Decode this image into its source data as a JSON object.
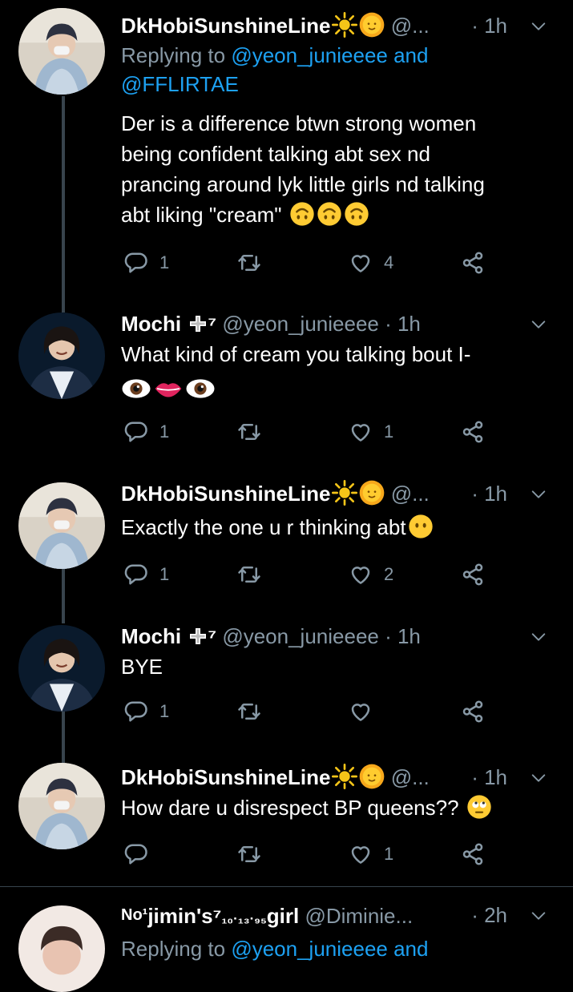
{
  "tweets": [
    {
      "name": "DkHobiSunshineLine",
      "handle": "@...",
      "time": "· 1h",
      "reply_label": "Replying to",
      "reply_link1": "@yeon_junieeee and",
      "reply_link2": "@FFLIRTAE",
      "text_line1": "Der is a difference btwn strong women",
      "text_line2": "being confident talking abt sex nd",
      "text_line3": "prancing around lyk little girls nd talking",
      "text_line4": "abt liking \"cream\"",
      "replies": "1",
      "retweets": "",
      "likes": "4"
    },
    {
      "name": "Mochi",
      "name_suffix": "⁷",
      "handle": "@yeon_junieeee",
      "time": "· 1h",
      "text_line1": "What kind of cream you talking bout I-",
      "replies": "1",
      "retweets": "",
      "likes": "1"
    },
    {
      "name": "DkHobiSunshineLine",
      "handle": "@...",
      "time": "· 1h",
      "text_line1": "Exactly the one u r thinking abt",
      "replies": "1",
      "retweets": "",
      "likes": "2"
    },
    {
      "name": "Mochi",
      "name_suffix": "⁷",
      "handle": "@yeon_junieeee",
      "time": "· 1h",
      "text_line1": "BYE",
      "replies": "1",
      "retweets": "",
      "likes": ""
    },
    {
      "name": "DkHobiSunshineLine",
      "handle": "@...",
      "time": "· 1h",
      "text_line1": "How dare u disrespect BP queens??",
      "replies": "",
      "retweets": "",
      "likes": "1"
    },
    {
      "name_prefix": "No¹",
      "name": "jimin's",
      "name_sup": "⁷",
      "name_sub": "₁₀·₁₃·₉₅",
      "name_tail": "girl",
      "handle": "@Diminie...",
      "time": "· 2h",
      "reply_label": "Replying to",
      "reply_link1": "@yeon_junieeee and"
    }
  ],
  "colors": {
    "background": "#000000",
    "secondary": "#8899a6",
    "link": "#1da1f2",
    "line": "#38444d"
  },
  "icons": [
    "reply-icon",
    "retweet-icon",
    "like-icon",
    "share-icon",
    "chevron-down-icon",
    "sun-emoji",
    "upside-down-face-emoji",
    "eyes-emoji",
    "lips-emoji",
    "no-mouth-face-emoji",
    "eye-roll-face-emoji",
    "cross-emoji"
  ]
}
